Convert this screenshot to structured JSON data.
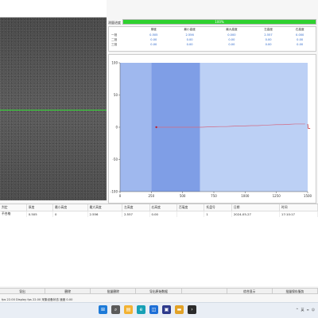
{
  "progress": {
    "label": "测量进度",
    "value_text": "100%",
    "fraction": 1.0
  },
  "stats": {
    "headers": [
      "",
      "厚度",
      "最小高度",
      "最大高度",
      "左高度",
      "右高度"
    ],
    "rows": [
      {
        "name": "一批",
        "values": [
          "0.505",
          "2.556",
          "0.000",
          "2.557",
          "0.000"
        ]
      },
      {
        "name": "二批",
        "values": [
          "0.00",
          "0.00",
          "0.00",
          "0.00",
          "0.00"
        ]
      },
      {
        "name": "三批",
        "values": [
          "0.00",
          "0.00",
          "0.00",
          "0.00",
          "0.00"
        ]
      }
    ]
  },
  "chart_data": {
    "type": "line",
    "x_ticks": [
      "0",
      "250",
      "500",
      "750",
      "1000",
      "1250",
      "1500"
    ],
    "y_ticks": [
      "100",
      "50",
      "0",
      "-50",
      "-100"
    ],
    "xlim": [
      0,
      1500
    ],
    "ylim": [
      -100,
      100
    ],
    "regions": [
      {
        "x0": 0,
        "x1": 250,
        "color": "#9fb8ee"
      },
      {
        "x0": 250,
        "x1": 640,
        "color": "#7f9ee6"
      },
      {
        "x0": 640,
        "x1": 1500,
        "color": "#bcd0f5"
      }
    ],
    "series": [
      {
        "color": "#d26a84",
        "x": [
          300,
          350,
          400,
          450,
          500,
          550,
          600,
          650,
          700,
          750,
          800,
          850,
          900,
          950,
          1000,
          1050,
          1100,
          1150,
          1200,
          1250,
          1300,
          1350,
          1400,
          1450,
          1480
        ],
        "y": [
          0,
          0,
          0,
          0,
          0,
          0,
          0,
          0,
          0.5,
          0.8,
          1,
          1,
          1.5,
          2,
          2,
          2.5,
          2.5,
          3,
          3.5,
          4,
          4,
          4.5,
          5,
          5,
          5
        ]
      },
      {
        "color": "#c0202a",
        "x": [
          1500,
          1505,
          1510,
          1520
        ],
        "y": [
          5,
          -2,
          -2,
          -2
        ]
      }
    ],
    "marker": {
      "x": 290,
      "y": 0,
      "color": "#c0202a"
    }
  },
  "result_table": {
    "headers": [
      "判定",
      "厚度",
      "最小高度",
      "最大高度",
      "左高度",
      "右高度",
      "百毫度",
      "托盘号",
      "日期",
      "时间"
    ],
    "rows": [
      [
        "不合格",
        "0.505",
        "0",
        "2.556",
        "2.557",
        "0.00",
        "",
        "1",
        "2024-05-27",
        "17:10:17"
      ]
    ]
  },
  "buttons": [
    "导出",
    "删除",
    "批量删除",
    "导出原始数据",
    "",
    "综合显示",
    "批量保存服务"
  ],
  "status_text": "fps 22.00  Display fps 22.00  采集设备状态 速度 0.00",
  "systray": {
    "lang": "英",
    "icons": [
      "^",
      "≡",
      "☺"
    ]
  },
  "taskbar_icons": [
    {
      "name": "windows-icon",
      "glyph": "⊞",
      "color": "#1c7ad8"
    },
    {
      "name": "search-icon",
      "glyph": "⌕",
      "color": "#5a5a5a"
    },
    {
      "name": "files-icon",
      "glyph": "▤",
      "color": "#f2b233"
    },
    {
      "name": "edge-icon",
      "glyph": "e",
      "color": "#17a0b5"
    },
    {
      "name": "store-icon",
      "glyph": "◫",
      "color": "#1e6fd6"
    },
    {
      "name": "app-icon",
      "glyph": "▣",
      "color": "#2d3a8c"
    },
    {
      "name": "folder-icon",
      "glyph": "▬",
      "color": "#e2a227"
    },
    {
      "name": "terminal-icon",
      "glyph": "›",
      "color": "#2b2b2b"
    }
  ]
}
